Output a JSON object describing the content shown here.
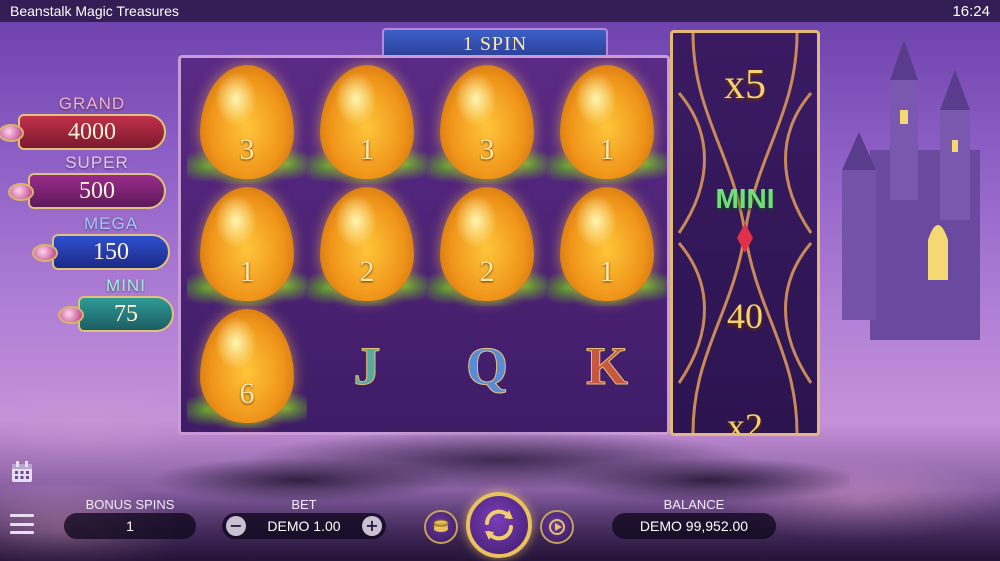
{
  "app": {
    "title": "Beanstalk Magic Treasures",
    "clock": "16:24"
  },
  "banner": {
    "spin_text": "1 SPIN"
  },
  "jackpots": [
    {
      "label": "GRAND",
      "value": "4000"
    },
    {
      "label": "SUPER",
      "value": "500"
    },
    {
      "label": "MEGA",
      "value": "150"
    },
    {
      "label": "MINI",
      "value": "75"
    }
  ],
  "reels": {
    "row1": [
      "3",
      "1",
      "3",
      "1"
    ],
    "row2": [
      "1",
      "2",
      "2",
      "1"
    ],
    "row3": {
      "egg": "6",
      "letters": [
        "J",
        "Q",
        "K"
      ]
    }
  },
  "multiplier_panel": {
    "items": [
      "x5",
      "MINI",
      "40",
      "x2"
    ]
  },
  "bottom_bar": {
    "bonus_spins": {
      "label": "BONUS SPINS",
      "value": "1"
    },
    "bet": {
      "label": "BET",
      "value": "DEMO 1.00",
      "minus": "−",
      "plus": "+"
    },
    "balance": {
      "label": "BALANCE",
      "value": "DEMO 99,952.00"
    }
  },
  "icons": {
    "calendar": "calendar-icon",
    "menu": "hamburger-menu-icon",
    "spin": "spin-arrows-icon",
    "coins": "coins-icon",
    "autoplay": "autoplay-icon"
  },
  "colors": {
    "background_top": "#6a3fa8",
    "reel_frame": "#c89bd8",
    "gold_accent": "#e9c25e",
    "grand": "#c0304a",
    "super": "#9a2b8a",
    "mega": "#2f4fd0",
    "mini": "#2f9a96"
  }
}
